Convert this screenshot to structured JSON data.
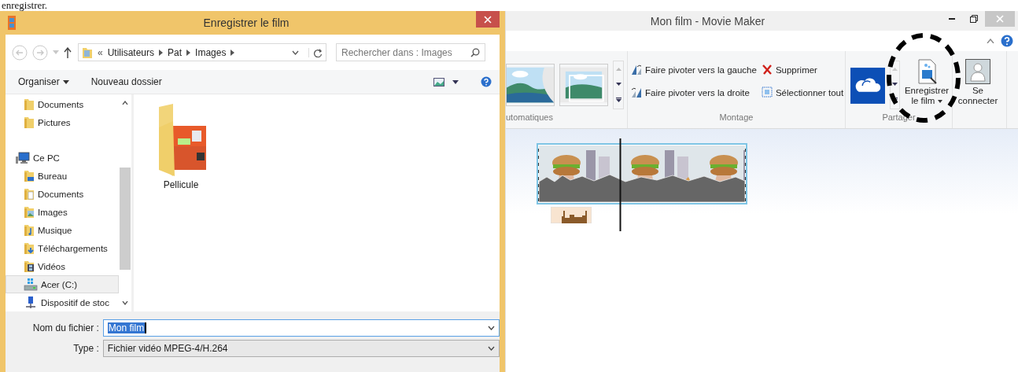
{
  "document_text": "enregistrer.",
  "dialog": {
    "title": "Enregistrer le film",
    "breadcrumb_prefix": "«",
    "breadcrumb": [
      "Utilisateurs",
      "Pat",
      "Images"
    ],
    "search": {
      "placeholder": "Rechercher dans : Images"
    },
    "toolbar": [
      "Organiser",
      "Nouveau dossier"
    ],
    "nav_sections": [
      {
        "children": [
          {
            "label": "Documents",
            "kind": "folder",
            "selected": false
          },
          {
            "label": "Pictures",
            "kind": "folder",
            "selected": false
          }
        ]
      },
      {
        "label": "Ce PC",
        "kind": "pc",
        "selected": false,
        "children": [
          {
            "label": "Bureau",
            "kind": "desktop",
            "selected": false
          },
          {
            "label": "Documents",
            "kind": "docs",
            "selected": false
          },
          {
            "label": "Images",
            "kind": "images",
            "selected": false
          },
          {
            "label": "Musique",
            "kind": "music",
            "selected": false
          },
          {
            "label": "Téléchargements",
            "kind": "downloads",
            "selected": false
          },
          {
            "label": "Vidéos",
            "kind": "videos",
            "selected": false
          },
          {
            "label": "Acer (C:)",
            "kind": "drive",
            "selected": true
          },
          {
            "label": "Dispositif de stoc",
            "kind": "device",
            "selected": false
          }
        ]
      }
    ],
    "files": [
      {
        "name": "Pellicule"
      }
    ],
    "fields": [
      {
        "label": "Nom du fichier :",
        "value": "Mon film",
        "kind": "input",
        "highlighted": true
      },
      {
        "label": "Type :",
        "value": "Fichier vidéo MPEG-4/H.264",
        "kind": "select",
        "highlighted": false
      }
    ]
  },
  "app": {
    "title": "Mon film - Movie Maker",
    "ribbon_groups": [
      {
        "label": "utomatiques",
        "kind": "themes"
      },
      {
        "label": "Montage",
        "kind": "commands",
        "commands": [
          {
            "label": "Faire pivoter vers la gauche",
            "kind": "rotate-left"
          },
          {
            "label": "Supprimer",
            "kind": "delete"
          },
          {
            "label": "Faire pivoter vers la droite",
            "kind": "rotate-right"
          },
          {
            "label": "Sélectionner tout",
            "kind": "select-all"
          }
        ]
      },
      {
        "label": "Partager",
        "kind": "share",
        "button": "Enregistrer le film"
      },
      {
        "kind": "account",
        "button": "Se connecter"
      }
    ]
  }
}
